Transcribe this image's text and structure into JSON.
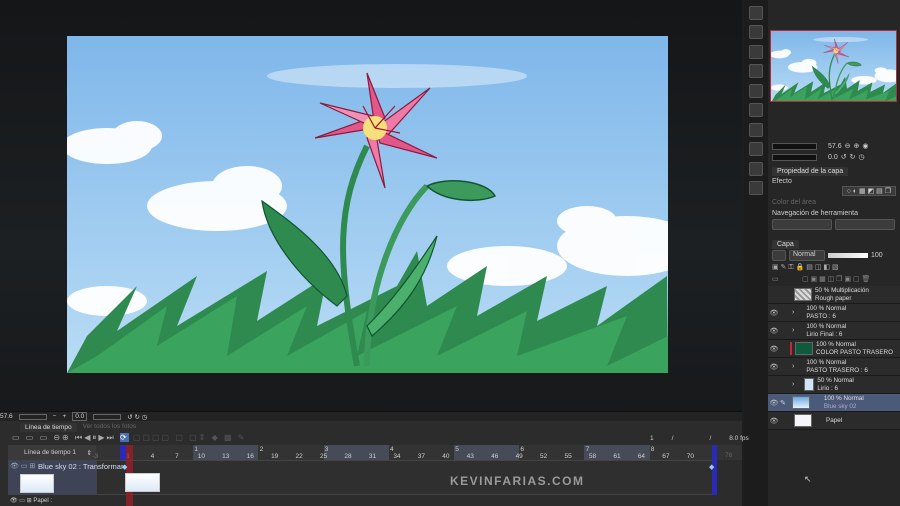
{
  "canvas": {
    "zoom_value": "57.6",
    "rotation_value": "0.0"
  },
  "navigator": {
    "zoom_value": "57.6",
    "rotation_value": "0.0"
  },
  "layer_property": {
    "tab_label": "Propiedad de la capa",
    "effect_label": "Efecto",
    "area_color_label": "Color del área",
    "tool_nav_label": "Navegación de herramienta"
  },
  "layers_panel": {
    "tab_label": "Capa",
    "blend_mode": "Normal",
    "opacity": "100",
    "layers": [
      {
        "mode": "50 % Multiplicación",
        "name": "Rough paper",
        "visible": false
      },
      {
        "mode": "100 % Normal",
        "name": "PASTO : 6",
        "visible": true
      },
      {
        "mode": "100 % Normal",
        "name": "Lirio Final : 6",
        "visible": true
      },
      {
        "mode": "100 % Normal",
        "name": "COLOR PASTO TRASERO",
        "visible": true
      },
      {
        "mode": "100 % Normal",
        "name": "PASTO TRASERO : 6",
        "visible": true
      },
      {
        "mode": "50 % Normal",
        "name": "Lirio : 6",
        "visible": false
      },
      {
        "mode": "100 % Normal",
        "name": "Blue sky 02",
        "visible": true,
        "selected": true
      },
      {
        "mode": "",
        "name": "Papel",
        "visible": true
      }
    ]
  },
  "timeline": {
    "tab_label": "Línea de tiempo",
    "tab2_label": "Ver todos los fotos",
    "timeline_name": "Línea de tiempo 1",
    "current_frame": "1",
    "separator": "/",
    "fps": "8.0 fps",
    "end_frame_label": "76",
    "frame_labels": [
      "-3",
      "1",
      "4",
      "7",
      "10",
      "13",
      "16",
      "19",
      "22",
      "25",
      "28",
      "31",
      "34",
      "37",
      "40",
      "43",
      "46",
      "49",
      "52",
      "55",
      "58",
      "61",
      "64",
      "67",
      "70"
    ],
    "second_labels": [
      "1",
      "2",
      "3",
      "4",
      "5",
      "6",
      "7",
      "8"
    ],
    "tracks": [
      {
        "name": "Blue sky 02 : Transformar"
      },
      {
        "name": "Papel :"
      }
    ]
  },
  "watermark": "KEVINFARIAS.COM",
  "colors": {
    "accent": "#c0283a",
    "selection": "#4c5a7a",
    "playhead": "#2a2ab8"
  }
}
